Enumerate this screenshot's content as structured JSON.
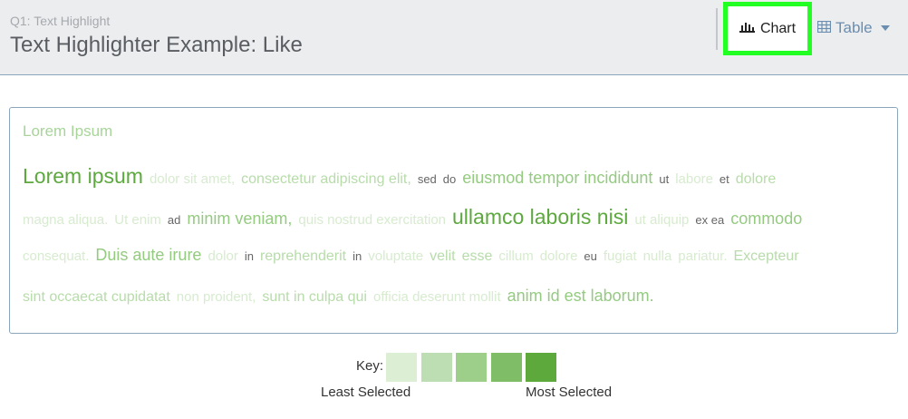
{
  "header": {
    "subtitle": "Q1: Text Highlight",
    "title": "Text Highlighter Example: Like",
    "chart_button_label": "Chart",
    "table_button_label": "Table"
  },
  "panel": {
    "title": "Lorem Ipsum",
    "lines": [
      [
        {
          "t": "Lorem ipsum",
          "s": 5
        },
        {
          "t": "dolor sit amet,",
          "s": 1
        },
        {
          "t": "consectetur adipiscing elit,",
          "s": 2
        },
        {
          "t": "sed",
          "s": 0
        },
        {
          "t": "do",
          "s": 0
        },
        {
          "t": "eiusmod tempor incididunt",
          "s": 3
        },
        {
          "t": "ut",
          "s": 0
        },
        {
          "t": "labore",
          "s": 1
        },
        {
          "t": "et",
          "s": 0
        },
        {
          "t": "dolore",
          "s": 2
        }
      ],
      [
        {
          "t": "magna aliqua.",
          "s": 1
        },
        {
          "t": "Ut enim",
          "s": 1
        },
        {
          "t": "ad",
          "s": 0
        },
        {
          "t": "minim veniam,",
          "s": 3
        },
        {
          "t": "quis nostrud exercitation",
          "s": 1
        },
        {
          "t": "ullamco laboris nisi",
          "s": 5
        },
        {
          "t": "ut aliquip",
          "s": 1
        },
        {
          "t": "ex ea",
          "s": 0
        },
        {
          "t": "commodo",
          "s": 3
        }
      ],
      [
        {
          "t": "consequat.",
          "s": 1
        },
        {
          "t": "Duis aute irure",
          "s": 3
        },
        {
          "t": "dolor",
          "s": 1
        },
        {
          "t": "in",
          "s": 0
        },
        {
          "t": "reprehenderit",
          "s": 2
        },
        {
          "t": "in",
          "s": 0
        },
        {
          "t": "voluptate",
          "s": 1
        },
        {
          "t": "velit",
          "s": 2
        },
        {
          "t": "esse",
          "s": 2
        },
        {
          "t": "cillum",
          "s": 1
        },
        {
          "t": "dolore",
          "s": 1
        },
        {
          "t": "eu",
          "s": 0
        },
        {
          "t": "fugiat",
          "s": 1
        },
        {
          "t": "nulla",
          "s": 1
        },
        {
          "t": "pariatur.",
          "s": 1
        },
        {
          "t": "Excepteur",
          "s": 2
        }
      ],
      [
        {
          "t": "sint occaecat cupidatat",
          "s": 2
        },
        {
          "t": "non proident,",
          "s": 1
        },
        {
          "t": "sunt in culpa qui",
          "s": 2
        },
        {
          "t": "officia deserunt mollit",
          "s": 1
        },
        {
          "t": "anim id est laborum.",
          "s": 3
        }
      ]
    ]
  },
  "key": {
    "label": "Key:",
    "least": "Least Selected",
    "most": "Most Selected",
    "colors": [
      "#dcefd5",
      "#bddeb2",
      "#9dcf8b",
      "#7fbe66",
      "#5ea93c"
    ]
  },
  "icons": {
    "chart_button": "bar-chart-icon",
    "table_button": "table-icon",
    "dropdown": "caret-down-icon"
  }
}
